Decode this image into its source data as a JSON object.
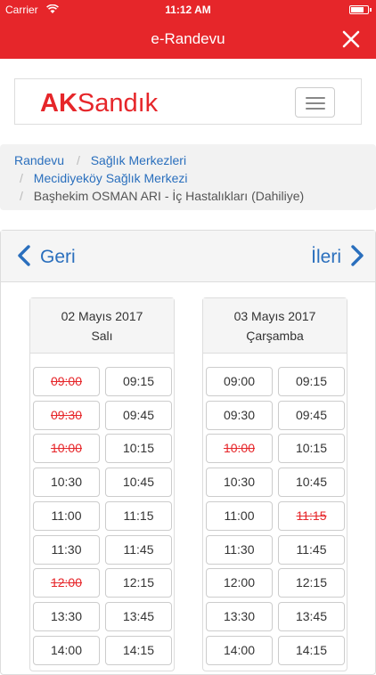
{
  "status_bar": {
    "carrier": "Carrier",
    "time": "11:12 AM"
  },
  "nav": {
    "title": "e-Randevu"
  },
  "brand": {
    "logo_bold": "AK",
    "logo_rest": "Sandık"
  },
  "breadcrumb": {
    "items": [
      "Randevu",
      "Sağlık Merkezleri",
      "Mecidiyeköy Sağlık Merkezi"
    ],
    "active": "Başhekim OSMAN ARI - İç Hastalıkları (Dahiliye)",
    "separator": "/"
  },
  "pager": {
    "prev_label": "Geri",
    "next_label": "İleri"
  },
  "days": [
    {
      "date": "02 Mayıs 2017",
      "weekday": "Salı",
      "slots": [
        {
          "time": "09:00",
          "taken": true
        },
        {
          "time": "09:15",
          "taken": false
        },
        {
          "time": "09:30",
          "taken": true
        },
        {
          "time": "09:45",
          "taken": false
        },
        {
          "time": "10:00",
          "taken": true
        },
        {
          "time": "10:15",
          "taken": false
        },
        {
          "time": "10:30",
          "taken": false
        },
        {
          "time": "10:45",
          "taken": false
        },
        {
          "time": "11:00",
          "taken": false
        },
        {
          "time": "11:15",
          "taken": false
        },
        {
          "time": "11:30",
          "taken": false
        },
        {
          "time": "11:45",
          "taken": false
        },
        {
          "time": "12:00",
          "taken": true
        },
        {
          "time": "12:15",
          "taken": false
        },
        {
          "time": "13:30",
          "taken": false
        },
        {
          "time": "13:45",
          "taken": false
        },
        {
          "time": "14:00",
          "taken": false
        },
        {
          "time": "14:15",
          "taken": false
        }
      ]
    },
    {
      "date": "03 Mayıs 2017",
      "weekday": "Çarşamba",
      "slots": [
        {
          "time": "09:00",
          "taken": false
        },
        {
          "time": "09:15",
          "taken": false
        },
        {
          "time": "09:30",
          "taken": false
        },
        {
          "time": "09:45",
          "taken": false
        },
        {
          "time": "10:00",
          "taken": true
        },
        {
          "time": "10:15",
          "taken": false
        },
        {
          "time": "10:30",
          "taken": false
        },
        {
          "time": "10:45",
          "taken": false
        },
        {
          "time": "11:00",
          "taken": false
        },
        {
          "time": "11:15",
          "taken": true
        },
        {
          "time": "11:30",
          "taken": false
        },
        {
          "time": "11:45",
          "taken": false
        },
        {
          "time": "12:00",
          "taken": false
        },
        {
          "time": "12:15",
          "taken": false
        },
        {
          "time": "13:30",
          "taken": false
        },
        {
          "time": "13:45",
          "taken": false
        },
        {
          "time": "14:00",
          "taken": false
        },
        {
          "time": "14:15",
          "taken": false
        }
      ]
    }
  ],
  "colors": {
    "brand_red": "#e6262a",
    "link_blue": "#2a6fbd"
  },
  "icons": {
    "close": "close-icon",
    "menu": "hamburger-icon",
    "prev": "chevron-left-icon",
    "next": "chevron-right-icon"
  }
}
